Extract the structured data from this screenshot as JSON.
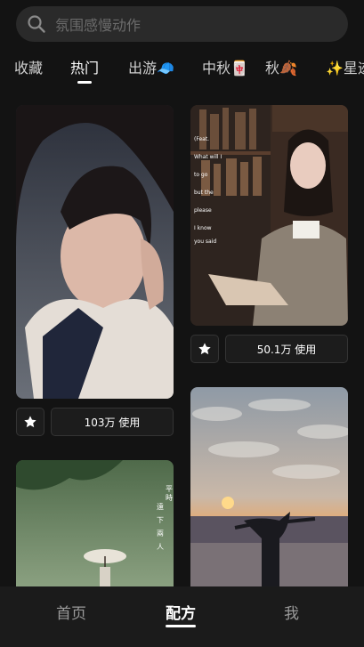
{
  "search": {
    "placeholder": "氛围感慢动作",
    "icon": "search-icon"
  },
  "tabs": [
    {
      "label": "收藏"
    },
    {
      "label": "热门",
      "active": true
    },
    {
      "label": "出游🧢"
    },
    {
      "label": "中秋🀄"
    },
    {
      "label": "秋🍂"
    },
    {
      "label": "✨星迹"
    }
  ],
  "cards": [
    {
      "usage": "103万 使用"
    },
    {
      "usage": "50.1万 使用"
    }
  ],
  "bottom_nav": [
    {
      "label": "首页"
    },
    {
      "label": "配方",
      "active": true
    },
    {
      "label": "我"
    }
  ],
  "colors": {
    "background": "#131313",
    "surface": "#1c1c1c",
    "search_bg": "#2a2a2a",
    "text_muted": "#9a9a9a"
  }
}
